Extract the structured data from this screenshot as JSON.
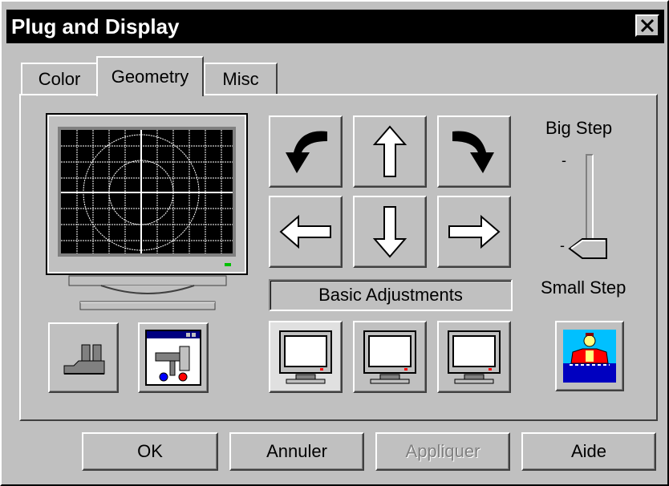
{
  "window": {
    "title": "Plug and Display"
  },
  "tabs": [
    {
      "label": "Color"
    },
    {
      "label": "Geometry"
    },
    {
      "label": "Misc"
    }
  ],
  "geometry": {
    "mode_label": "Basic Adjustments",
    "slider": {
      "top_label": "Big Step",
      "bottom_label": "Small Step",
      "position": 1.0
    }
  },
  "buttons": {
    "ok": "OK",
    "cancel": "Annuler",
    "apply": "Appliquer",
    "help": "Aide"
  },
  "icons": {
    "close": "close-icon",
    "rotate_left": "rotate-left-icon",
    "arrow_up": "arrow-up-icon",
    "rotate_right": "rotate-right-icon",
    "arrow_left": "arrow-left-icon",
    "arrow_down": "arrow-down-icon",
    "arrow_right": "arrow-right-icon",
    "factory": "factory-icon",
    "toolbox": "toolbox-window-icon",
    "monitor": "monitor-icon",
    "character": "character-icon"
  },
  "colors": {
    "face": "#c0c0c0",
    "titlebar": "#000000",
    "screen": "#000000",
    "power_led": "#00c000"
  }
}
